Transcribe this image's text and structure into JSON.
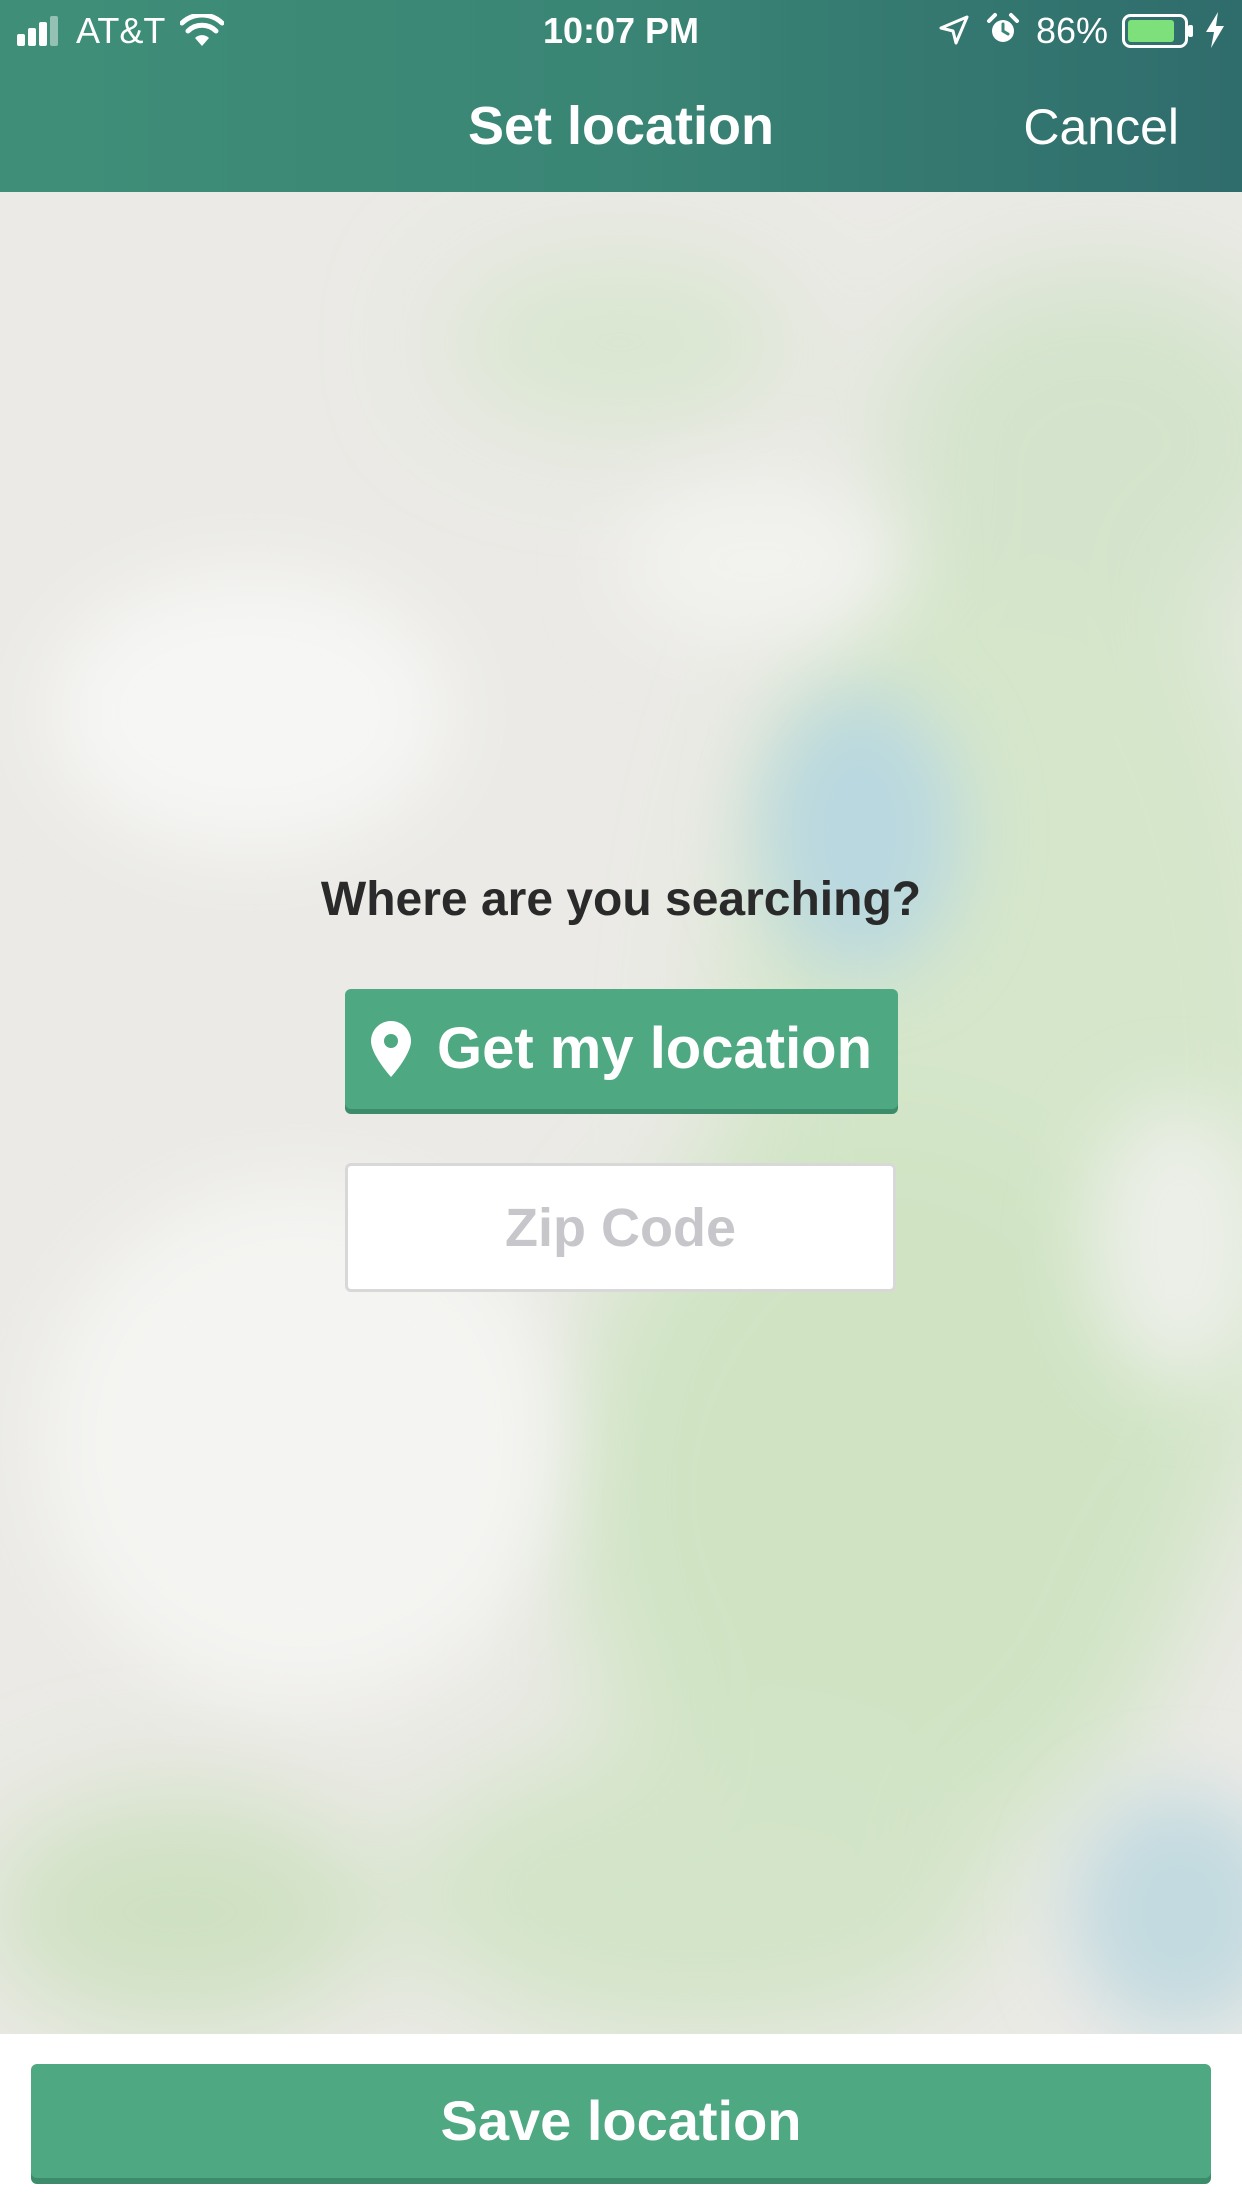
{
  "status_bar": {
    "carrier": "AT&T",
    "time": "10:07 PM",
    "battery_percent": "86%",
    "icons": [
      "signal-icon",
      "wifi-icon",
      "location-arrow-icon",
      "alarm-icon",
      "battery-icon",
      "charging-bolt-icon"
    ],
    "battery_level": 0.86
  },
  "nav": {
    "title": "Set location",
    "cancel_label": "Cancel"
  },
  "main": {
    "prompt": "Where are you searching?",
    "get_location_label": "Get my location",
    "get_location_icon": "location-pin-icon",
    "zip_placeholder": "Zip Code",
    "zip_value": ""
  },
  "footer": {
    "save_label": "Save location"
  },
  "colors": {
    "header_start": "#3f8f78",
    "header_end": "#2f6c6c",
    "accent_green": "#4ea882",
    "map_background": "#ebeae6",
    "map_green": "#cfe3c2",
    "map_water": "#b9d8e0"
  }
}
